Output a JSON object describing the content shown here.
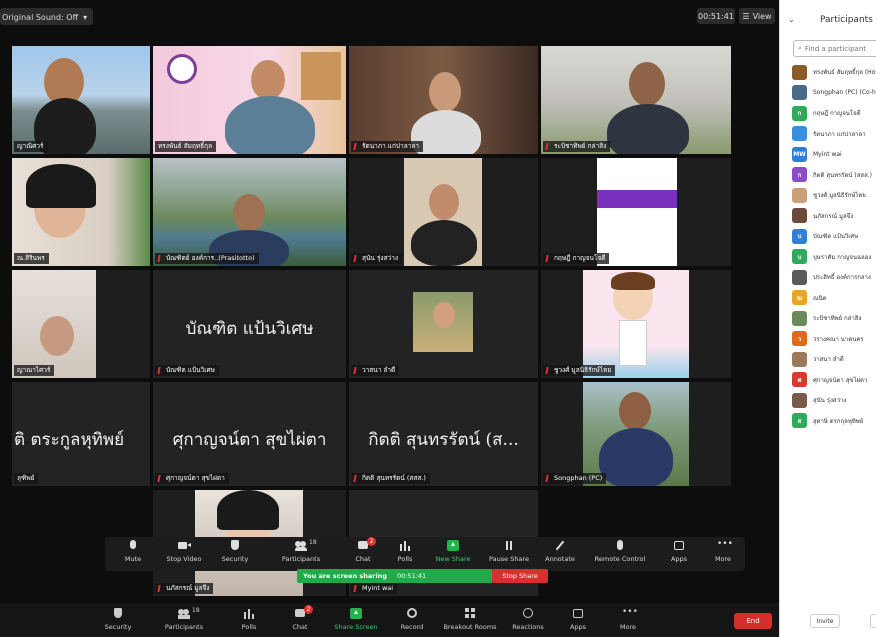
{
  "top_bar": {
    "original_sound": "Original Sound: Off",
    "timer": "00:51:41",
    "view": "View"
  },
  "tiles": [
    {
      "name": "ญาณิศวร์"
    },
    {
      "name": "ทรงพันธ์ สัมฤทธิ์กุล"
    },
    {
      "name": "รัตนาภา แก่ปาลาลา"
    },
    {
      "name": "ระบิชาทิพย์ กล่าสิง"
    },
    {
      "name": "ณ.สิรินพร"
    },
    {
      "name": "บัณฑิตย์ องค์การ..(Prasitotto)"
    },
    {
      "name": "สุนัน รุ่งสว่าง"
    },
    {
      "name": "กฤษฎี กาญจนโจตี"
    },
    {
      "name": "ญาณาไศวร์"
    },
    {
      "name": "บัณฑิต แป้นวิเศษ",
      "display": "บัณฑิต แป้นวิเศษ"
    },
    {
      "name": "วาสนา ลำดี"
    },
    {
      "name": "ชูวงศ์ มูลนิธิรักษ์ไทย"
    },
    {
      "name": "ลุฑิพย์",
      "display": "ติ ตระกูลหุทิพย์"
    },
    {
      "name": "ศุกาญจน์ตา สุขไผ่ตา",
      "display": "ศุกาญจน์ตา สุขไผ่ตา"
    },
    {
      "name": "กิตติ สุนทรรัตน์ (สสส.)",
      "display": "กิตติ สุนทรรัตน์ (ส..."
    },
    {
      "name": "Songphan (PC)"
    },
    {
      "name": "นภัสกรณ์ มูลจึง"
    },
    {
      "name": "Myint wai"
    }
  ],
  "meeting_controls": [
    {
      "label": "Mute",
      "icon": "microphone-icon"
    },
    {
      "label": "Stop Video",
      "icon": "video-camera-icon"
    },
    {
      "label": "Security",
      "icon": "shield-icon"
    },
    {
      "label": "Participants",
      "icon": "participants-icon",
      "count": "18"
    },
    {
      "label": "Chat",
      "icon": "chat-icon",
      "badge": "2"
    },
    {
      "label": "Polls",
      "icon": "polls-icon"
    },
    {
      "label": "New Share",
      "icon": "share-arrow-icon"
    },
    {
      "label": "Pause Share",
      "icon": "pause-icon"
    },
    {
      "label": "Annotate",
      "icon": "pen-icon"
    },
    {
      "label": "Remote Control",
      "icon": "mouse-icon"
    },
    {
      "label": "Apps",
      "icon": "apps-icon"
    },
    {
      "label": "More",
      "icon": "more-dots-icon"
    }
  ],
  "share_bar": {
    "text": "You are screen sharing",
    "timer": "00:51:41",
    "stop_label": "Stop Share"
  },
  "bottom_controls": [
    {
      "label": "Security",
      "icon": "shield-icon"
    },
    {
      "label": "Participants",
      "icon": "participants-icon",
      "count": "18"
    },
    {
      "label": "Polls",
      "icon": "polls-icon"
    },
    {
      "label": "Chat",
      "icon": "chat-icon",
      "badge": "2"
    },
    {
      "label": "Share Screen",
      "icon": "share-arrow-icon"
    },
    {
      "label": "Record",
      "icon": "record-icon"
    },
    {
      "label": "Breakout Rooms",
      "icon": "breakout-icon"
    },
    {
      "label": "Reactions",
      "icon": "reactions-icon"
    },
    {
      "label": "Apps",
      "icon": "apps-icon"
    },
    {
      "label": "More",
      "icon": "more-dots-icon"
    }
  ],
  "end_label": "End",
  "panel": {
    "title": "Participants (18)",
    "search_placeholder": "Find a participant",
    "invite_label": "Invite",
    "participants": [
      {
        "name": "ทรงพันธ์ สัมฤทธิ์กุล (Host, me)",
        "initial": "",
        "color": "#8a5a2b"
      },
      {
        "name": "Songphan (PC) (Co-host)",
        "initial": "",
        "color": "#4a6a8a"
      },
      {
        "name": "กฤษฎี กาญจนโจตี",
        "initial": "ก",
        "color": "#2faa5a"
      },
      {
        "name": "รัตนาภา แก่ปาลาลา",
        "initial": "",
        "color": "#3a8ee0"
      },
      {
        "name": "Myint wai",
        "initial": "MW",
        "color": "#2f7fd6"
      },
      {
        "name": "กิตติ สุนทรรัตน์ (สสส.)",
        "initial": "ก",
        "color": "#8a4cc8"
      },
      {
        "name": "ชูวงศ์ มูลนิธิรักษ์ไทย",
        "initial": "",
        "color": "#c9a07a"
      },
      {
        "name": "นภัสกรณ์ มูลจึง",
        "initial": "",
        "color": "#6b4a3a"
      },
      {
        "name": "บัณฑิต แป้นวิเศษ",
        "initial": "บ",
        "color": "#2f7fd6"
      },
      {
        "name": "บุษราคัม กาญจนฉลอง",
        "initial": "บ",
        "color": "#2faa5a"
      },
      {
        "name": "ประสิทธิ์ องค์การกลาง",
        "initial": "",
        "color": "#5a5a5a"
      },
      {
        "name": "ณนิต",
        "initial": "ณ",
        "color": "#e8a52a"
      },
      {
        "name": "ระบิชาทิพย์ กล่าสิง",
        "initial": "",
        "color": "#6a8a5a"
      },
      {
        "name": "วรางคณา นาคนคร",
        "initial": "ว",
        "color": "#e06a1a"
      },
      {
        "name": "วาสนา ลำดี",
        "initial": "",
        "color": "#9a7a5a"
      },
      {
        "name": "ศุกาญจน์ตา สุขไผ่ตา",
        "initial": "ศ",
        "color": "#d63a2a"
      },
      {
        "name": "สุนัน รุ่งสว่าง",
        "initial": "",
        "color": "#7a5a4a"
      },
      {
        "name": "สุดาษิ ตรกกุลหุทิพย์",
        "initial": "ส",
        "color": "#2faa5a"
      }
    ]
  }
}
